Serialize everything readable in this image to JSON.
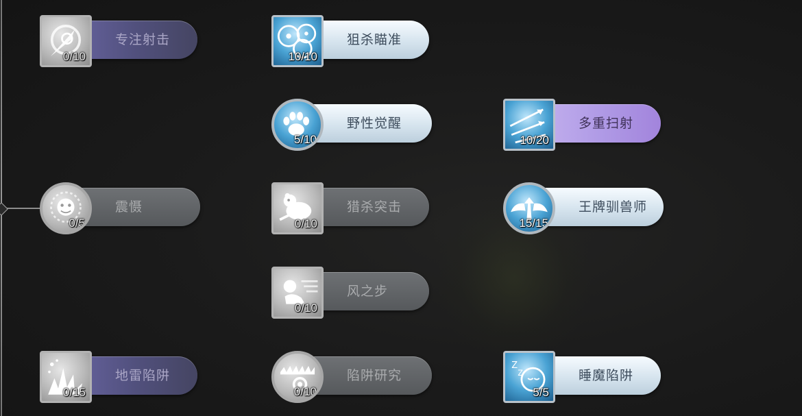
{
  "skills": [
    {
      "id": "zhuanzhu",
      "name": "专注射击",
      "count": "0/10"
    },
    {
      "id": "jusha",
      "name": "狙杀瞄准",
      "count": "10/10"
    },
    {
      "id": "yexing",
      "name": "野性觉醒",
      "count": "5/10"
    },
    {
      "id": "duozhong",
      "name": "多重扫射",
      "count": "10/20"
    },
    {
      "id": "zhenshe",
      "name": "震慑",
      "count": "0/5"
    },
    {
      "id": "liesha",
      "name": "猎杀突击",
      "count": "0/10"
    },
    {
      "id": "wangpai",
      "name": "王牌驯兽师",
      "count": "15/15"
    },
    {
      "id": "fengzhibu",
      "name": "风之步",
      "count": "0/10"
    },
    {
      "id": "dilei",
      "name": "地雷陷阱",
      "count": "0/15"
    },
    {
      "id": "xianjing",
      "name": "陷阱研究",
      "count": "0/10"
    },
    {
      "id": "shuimo",
      "name": "睡魔陷阱",
      "count": "5/5"
    }
  ]
}
